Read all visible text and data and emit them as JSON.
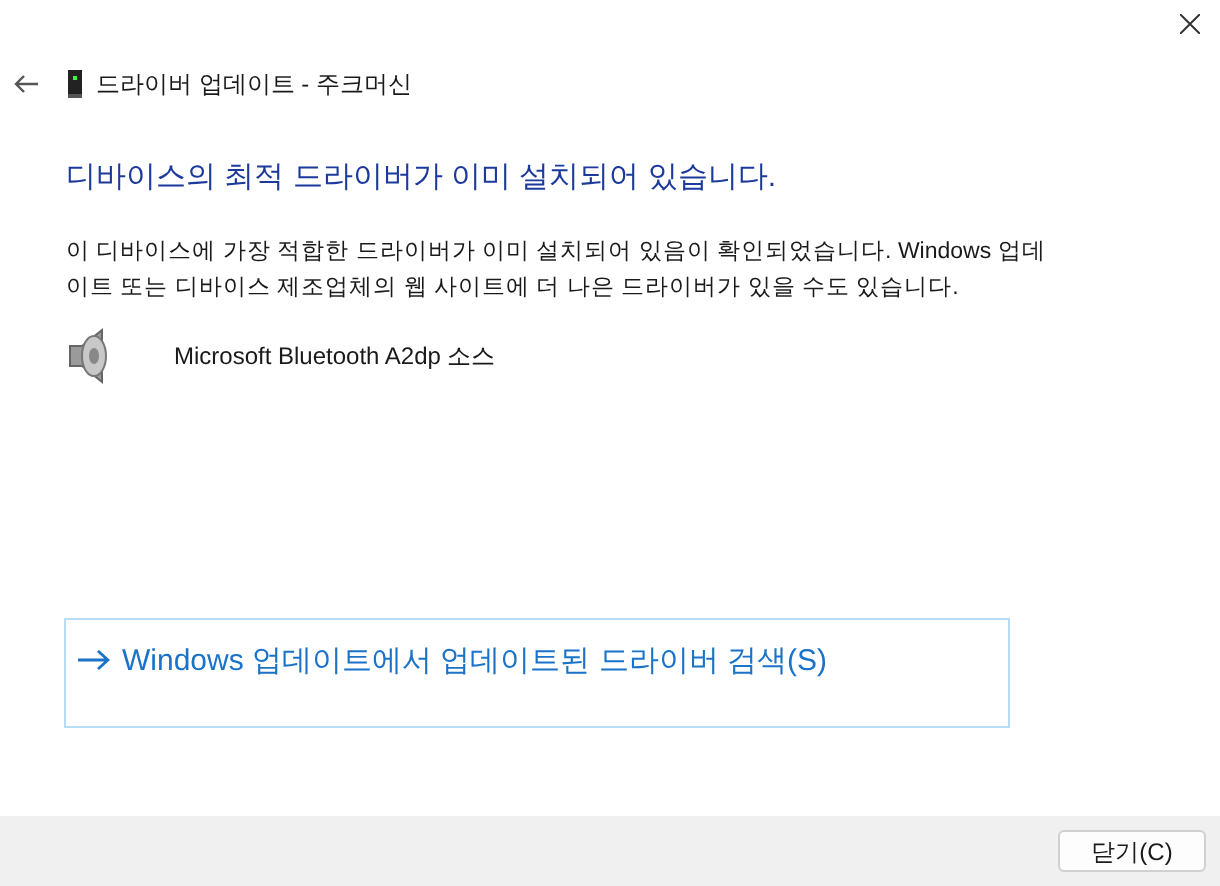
{
  "window": {
    "title": "드라이버 업데이트 - 주크머신"
  },
  "heading": "디바이스의 최적 드라이버가 이미 설치되어 있습니다.",
  "message": "이 디바이스에 가장 적합한 드라이버가 이미 설치되어 있음이 확인되었습니다. Windows 업데이트 또는 디바이스 제조업체의 웹 사이트에 더 나은 드라이버가 있을 수도 있습니다.",
  "device": {
    "name": "Microsoft Bluetooth A2dp 소스"
  },
  "link": {
    "label": "Windows 업데이트에서 업데이트된 드라이버 검색(S)"
  },
  "buttons": [
    "닫기(C)"
  ]
}
